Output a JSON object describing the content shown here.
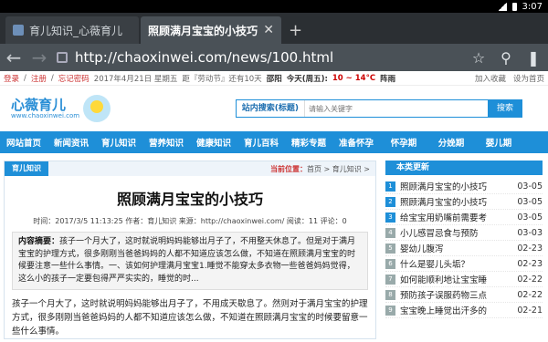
{
  "status": {
    "time": "3:07"
  },
  "tabs": [
    {
      "title": "育儿知识_心薇育儿"
    },
    {
      "title": "照顾满月宝宝的小技巧"
    }
  ],
  "address": {
    "url": "http://chaoxinwei.com/news/100.html"
  },
  "topinfo": {
    "login": "登录",
    "register": "注册",
    "forgot": "忘记密码",
    "date": "2017年4月21日 星期五",
    "holiday": "距『劳动节』还有10天",
    "city": "邵阳",
    "weather_day": "今天(周五):",
    "temp": "10 ~ 14°C",
    "weather": "阵雨",
    "favorite": "加入收藏",
    "homepage": "设为首页"
  },
  "logo": {
    "name": "心薇育儿",
    "url": "www.chaoxinwei.com"
  },
  "search": {
    "scope": "站内搜索(标题)",
    "placeholder": "请输入关键字",
    "button": "搜索"
  },
  "nav": [
    "网站首页",
    "新闻资讯",
    "育儿知识",
    "营养知识",
    "健康知识",
    "育儿百科",
    "精彩专题",
    "准备怀孕",
    "怀孕期",
    "分娩期",
    "婴儿期"
  ],
  "article": {
    "category": "育儿知识",
    "position_label": "当前位置：",
    "position_path": "首页 > 育儿知识 >",
    "title": "照顾满月宝宝的小技巧",
    "meta": "时间：2017/3/5 11:13:25  作者：育儿知识  来源：http://chaoxinwei.com/  阅读：11  评论：0",
    "summary_label": "内容摘要：",
    "summary": "孩子一个月大了，这时就说明妈妈能够出月子了，不用整天休息了。但是对于满月宝宝的护理方式，很多刚刚当爸爸妈妈的人都不知道应该怎么做，不知道在照顾满月宝宝的时候要注意一些什么事情。一、该如何护理满月宝宝1.睡觉不能穿太多衣物一些爸爸妈妈觉得，这么小的孩子一定要包得严严实实的，睡觉的时...",
    "body": "孩子一个月大了，这时就说明妈妈能够出月子了，不用成天歇息了。然则对于满月宝宝的护理方式，很多刚刚当爸爸妈妈的人都不知道应该怎么做，不知道在照顾满月宝宝的时候要留意一些什么事情。"
  },
  "sidebar": {
    "title": "本类更新",
    "items": [
      {
        "num": "1",
        "title": "照顾满月宝宝的小技巧",
        "date": "03-05"
      },
      {
        "num": "2",
        "title": "照顾满月宝宝的小技巧",
        "date": "03-05"
      },
      {
        "num": "3",
        "title": "给宝宝用奶嘴前需要考",
        "date": "03-05"
      },
      {
        "num": "4",
        "title": "小儿感冒忌食与预防",
        "date": "03-03"
      },
      {
        "num": "5",
        "title": "婴幼儿腹泻",
        "date": "02-23"
      },
      {
        "num": "6",
        "title": "什么是婴儿头垢？",
        "date": "02-23"
      },
      {
        "num": "7",
        "title": "如何能顺利地让宝宝睡",
        "date": "02-22"
      },
      {
        "num": "8",
        "title": "预防孩子误服药物三点",
        "date": "02-22"
      },
      {
        "num": "9",
        "title": "宝宝晚上睡觉出汗多的",
        "date": "02-21"
      }
    ]
  }
}
